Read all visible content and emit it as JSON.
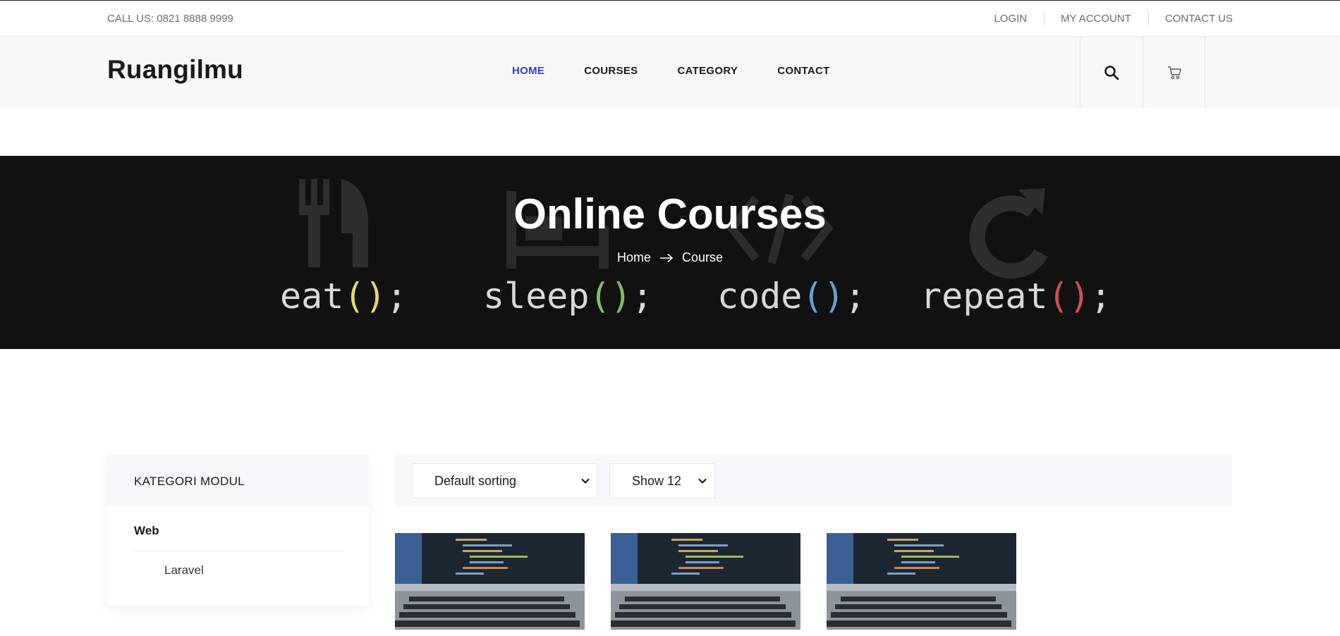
{
  "topbar": {
    "phone": "CALL US: 0821 8888 9999",
    "links": [
      "LOGIN",
      "MY ACCOUNT",
      "CONTACT US"
    ]
  },
  "header": {
    "logo": "Ruangilmu",
    "nav": [
      {
        "label": "HOME",
        "active": true
      },
      {
        "label": "COURSES",
        "active": false
      },
      {
        "label": "CATEGORY",
        "active": false
      },
      {
        "label": "CONTACT",
        "active": false
      }
    ],
    "icons": [
      "search-icon",
      "cart-icon"
    ],
    "accent_color": "#2b3ee6"
  },
  "hero": {
    "title": "Online Courses",
    "breadcrumb": {
      "home": "Home",
      "current": "Course"
    },
    "background_text": [
      "eat();",
      "sleep();",
      "code();",
      "repeat();"
    ]
  },
  "sidebar": {
    "heading": "KATEGORI MODUL",
    "category": "Web",
    "subcategory": "Laravel"
  },
  "toolbar": {
    "sort_selected": "Default sorting",
    "show_selected": "Show 12"
  },
  "courses": [
    {
      "image": "laptop-code-image"
    },
    {
      "image": "laptop-code-image"
    },
    {
      "image": "laptop-code-image"
    }
  ]
}
